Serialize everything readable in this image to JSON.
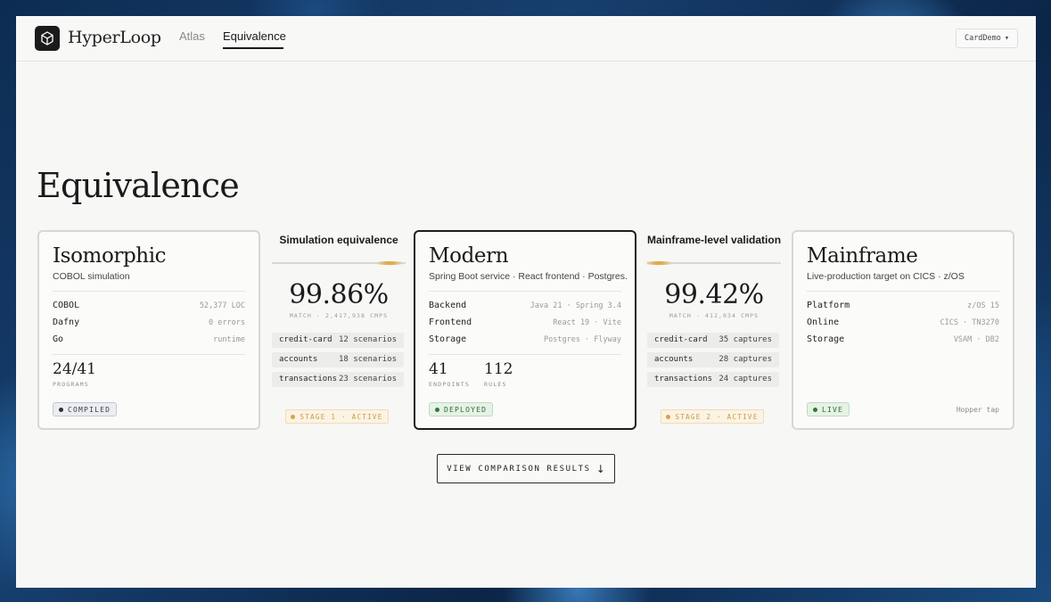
{
  "header": {
    "brand": "HyperLoop",
    "nav": [
      {
        "label": "Atlas",
        "active": false
      },
      {
        "label": "Equivalence",
        "active": true
      }
    ],
    "project_select": "CardDemo",
    "project_caret": "▾"
  },
  "page": {
    "title": "Equivalence"
  },
  "cards": {
    "isomorphic": {
      "title": "Isomorphic",
      "subtitle": "COBOL simulation",
      "rows": [
        {
          "key": "COBOL",
          "value": "52,377 LOC"
        },
        {
          "key": "Dafny",
          "value": "0 errors"
        },
        {
          "key": "Go",
          "value": "runtime"
        }
      ],
      "stats": [
        {
          "value": "24/41",
          "label": "PROGRAMS"
        }
      ],
      "badge": "COMPILED"
    },
    "modern": {
      "title": "Modern",
      "subtitle": "Spring Boot service · React frontend · Postgres.",
      "rows": [
        {
          "key": "Backend",
          "value": "Java 21 · Spring 3.4"
        },
        {
          "key": "Frontend",
          "value": "React 19 · Vite"
        },
        {
          "key": "Storage",
          "value": "Postgres · Flyway"
        }
      ],
      "stats": [
        {
          "value": "41",
          "label": "ENDPOINTS"
        },
        {
          "value": "112",
          "label": "RULES"
        }
      ],
      "badge": "DEPLOYED"
    },
    "mainframe": {
      "title": "Mainframe",
      "subtitle": "Live-production target on CICS · z/OS",
      "rows": [
        {
          "key": "Platform",
          "value": "z/OS 15"
        },
        {
          "key": "Online",
          "value": "CICS · TN3270"
        },
        {
          "key": "Storage",
          "value": "VSAM · DB2"
        }
      ],
      "badge": "LIVE",
      "footnote": "Hopper tap"
    }
  },
  "bridges": {
    "simulation": {
      "title": "Simulation equivalence",
      "percent": "99.86%",
      "subtitle": "MATCH · 2,417,938 CMPS",
      "rows": [
        {
          "key": "credit-card",
          "value": "12 scenarios"
        },
        {
          "key": "accounts",
          "value": "18 scenarios"
        },
        {
          "key": "transactions",
          "value": "23 scenarios"
        }
      ],
      "stage": "STAGE 1 · ACTIVE",
      "accent": "#e1ab4a"
    },
    "mainframe": {
      "title": "Mainframe-level validation",
      "percent": "99.42%",
      "subtitle": "MATCH · 412,034 CMPS",
      "rows": [
        {
          "key": "credit-card",
          "value": "35 captures"
        },
        {
          "key": "accounts",
          "value": "28 captures"
        },
        {
          "key": "transactions",
          "value": "24 captures"
        }
      ],
      "stage": "STAGE 2 · ACTIVE",
      "accent": "#e1ab4a"
    }
  },
  "cta": {
    "label": "VIEW COMPARISON RESULTS",
    "arrow": "↓"
  },
  "colors": {
    "background_blue": "#173f6e",
    "accent_amber": "#e1ab4a",
    "live_green": "#2d7a36",
    "ink": "#1b1b1b"
  }
}
